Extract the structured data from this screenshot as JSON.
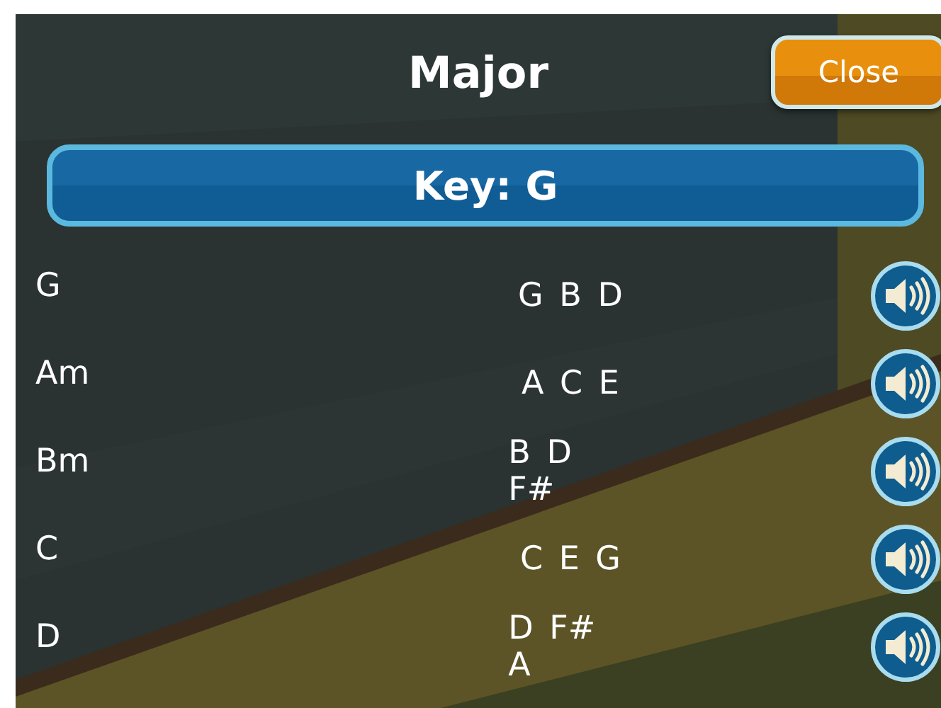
{
  "title": "Major",
  "close_button": "Close",
  "key_bar": "Key: G",
  "chords": [
    {
      "name": "G",
      "notes": "G B D"
    },
    {
      "name": "Am",
      "notes": "A C E"
    },
    {
      "name": "Bm",
      "notes": "B D F#"
    },
    {
      "name": "C",
      "notes": "C E G"
    },
    {
      "name": "D",
      "notes": "D F# A"
    }
  ]
}
